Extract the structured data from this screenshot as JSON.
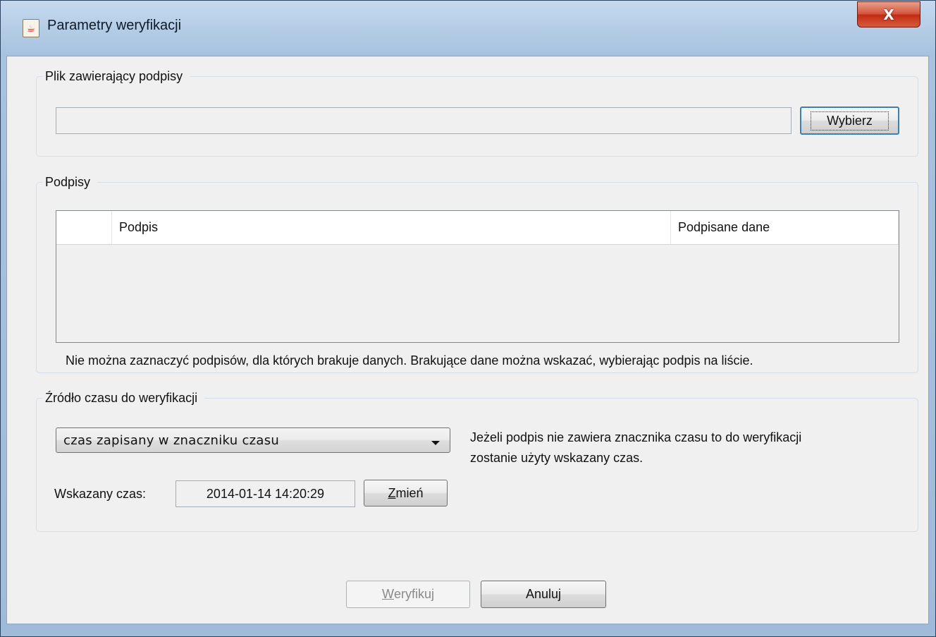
{
  "window": {
    "title": "Parametry weryfikacji",
    "close_glyph": "X"
  },
  "file_group": {
    "title": "Plik zawierający podpisy",
    "path_value": "",
    "choose_label": "Wybierz"
  },
  "signatures_group": {
    "title": "Podpisy",
    "columns": [
      "",
      "Podpis",
      "Podpisane dane"
    ],
    "rows": [],
    "hint": "Nie można zaznaczyć podpisów, dla których brakuje danych. Brakujące dane można wskazać, wybierając podpis na liście."
  },
  "time_group": {
    "title": "Źródło czasu do weryfikacji",
    "source_selected": "czas zapisany w znaczniku czasu",
    "note_line1": "Jeżeli podpis nie zawiera znacznika czasu to do weryfikacji",
    "note_line2": "zostanie użyty wskazany czas.",
    "time_label": "Wskazany czas:",
    "time_value": "2014-01-14 14:20:29",
    "change_mnemonic": "Z",
    "change_rest": "mień"
  },
  "actions": {
    "verify_mnemonic": "W",
    "verify_rest": "eryfikuj",
    "cancel_label": "Anuluj"
  }
}
